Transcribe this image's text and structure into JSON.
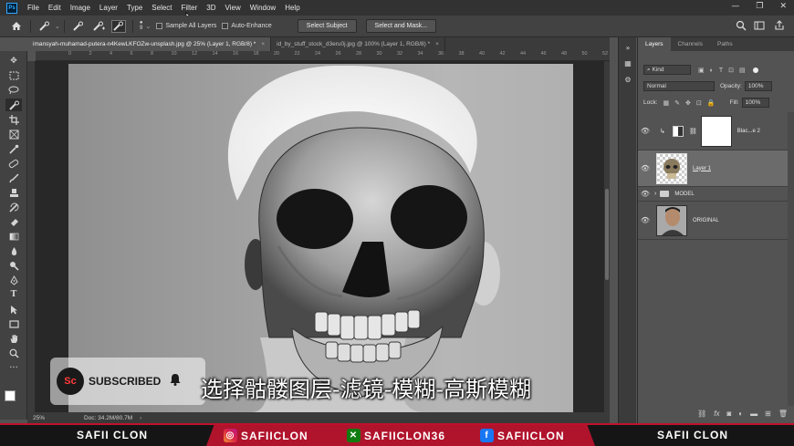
{
  "app": {
    "logo_text": "Ps"
  },
  "menu": [
    "File",
    "Edit",
    "Image",
    "Layer",
    "Type",
    "Select",
    "Filter",
    "3D",
    "View",
    "Window",
    "Help"
  ],
  "window_controls": [
    "—",
    "❐",
    "✕"
  ],
  "options": {
    "brush_size": "9",
    "sample_all_layers": "Sample All Layers",
    "auto_enhance": "Auto-Enhance",
    "select_subject": "Select Subject",
    "select_and_mask": "Select and Mask..."
  },
  "tabs": [
    {
      "label": "imansyah-muhamad-putera-n4KewLKFOZw-unsplash.jpg @ 25% (Layer 1, RGB/8) *",
      "active": true
    },
    {
      "label": "id_by_stuff_stock_d3eru0j.jpg @ 100% (Layer 1, RGB/8) *",
      "active": false
    }
  ],
  "ruler_labels": [
    "0",
    "2",
    "4",
    "6",
    "8",
    "10",
    "12",
    "14",
    "16",
    "18",
    "20",
    "22",
    "24",
    "26",
    "28",
    "30",
    "32",
    "34",
    "36",
    "38",
    "40",
    "42",
    "44",
    "46",
    "48",
    "50",
    "52"
  ],
  "status": {
    "zoom": "25%",
    "doc": "Doc: 34.2M/80.7M"
  },
  "panel": {
    "tabs": [
      "Layers",
      "Channels",
      "Paths"
    ],
    "filter_kind": "Kind",
    "blend_mode": "Normal",
    "opacity_label": "Opacity:",
    "opacity_value": "100%",
    "lock_label": "Lock:",
    "fill_label": "Fill:",
    "fill_value": "100%",
    "layers": [
      {
        "name": "Blac...e 2",
        "kind": "adjustment"
      },
      {
        "name": "Layer 1",
        "kind": "skull",
        "selected": true
      },
      {
        "name": "MODEL",
        "kind": "group"
      },
      {
        "name": "ORIGINAL",
        "kind": "photo"
      }
    ]
  },
  "overlay": {
    "badge_logo": "Sc",
    "badge_text": "SUBSCRIBED",
    "caption": "选择骷髅图层-滤镜-模糊-高斯模糊"
  },
  "banner": {
    "left": "SAFII CLON",
    "instagram": "SAFIICLON",
    "xbox": "SAFIICLON36",
    "facebook": "SAFIICLON",
    "right": "SAFII CLON"
  },
  "colors": {
    "accent_red": "#c0122b",
    "ps_blue": "#31a8ff"
  }
}
